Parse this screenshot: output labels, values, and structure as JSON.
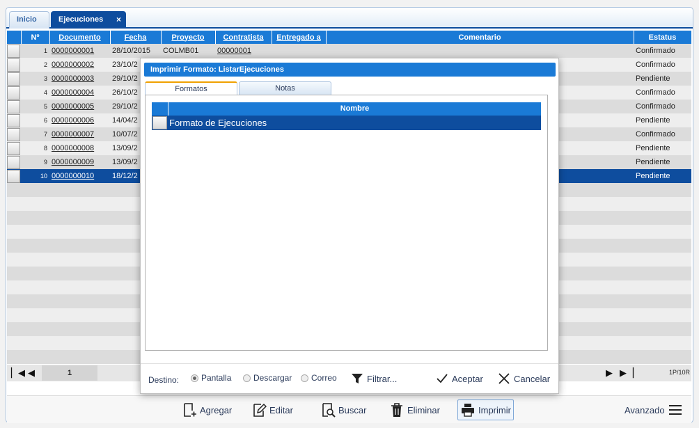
{
  "tabs": [
    {
      "label": "Inicio",
      "active": false
    },
    {
      "label": "Ejecuciones",
      "active": true,
      "close": "×"
    }
  ],
  "grid": {
    "columns": [
      "Nº",
      "Documento",
      "Fecha",
      "Proyecto",
      "Contratista",
      "Entregado a",
      "Comentario",
      "Estatus"
    ],
    "rows": [
      {
        "n": "1",
        "doc": "0000000001",
        "fecha": "28/10/2015",
        "proyecto": "COLMB01",
        "contratista": "00000001",
        "estatus": "Confirmado"
      },
      {
        "n": "2",
        "doc": "0000000002",
        "fecha": "23/10/2",
        "proyecto": "",
        "contratista": "",
        "estatus": "Confirmado"
      },
      {
        "n": "3",
        "doc": "0000000003",
        "fecha": "29/10/2",
        "proyecto": "",
        "contratista": "",
        "estatus": "Pendiente"
      },
      {
        "n": "4",
        "doc": "0000000004",
        "fecha": "26/10/2",
        "proyecto": "",
        "contratista": "",
        "estatus": "Confirmado"
      },
      {
        "n": "5",
        "doc": "0000000005",
        "fecha": "29/10/2",
        "proyecto": "",
        "contratista": "",
        "estatus": "Confirmado"
      },
      {
        "n": "6",
        "doc": "0000000006",
        "fecha": "14/04/2",
        "proyecto": "",
        "contratista": "",
        "estatus": "Pendiente"
      },
      {
        "n": "7",
        "doc": "0000000007",
        "fecha": "10/07/2",
        "proyecto": "",
        "contratista": "",
        "estatus": "Confirmado"
      },
      {
        "n": "8",
        "doc": "0000000008",
        "fecha": "13/09/2",
        "proyecto": "",
        "contratista": "",
        "estatus": "Pendiente"
      },
      {
        "n": "9",
        "doc": "0000000009",
        "fecha": "13/09/2",
        "proyecto": "",
        "contratista": "",
        "estatus": "Pendiente"
      },
      {
        "n": "10",
        "doc": "0000000010",
        "fecha": "18/12/2",
        "proyecto": "",
        "contratista": "",
        "estatus": "Pendiente",
        "selected": true
      }
    ],
    "empty_rows": 13
  },
  "pager": {
    "page": "1",
    "info": "1P/10R"
  },
  "toolbar": {
    "agregar": "Agregar",
    "editar": "Editar",
    "buscar": "Buscar",
    "eliminar": "Eliminar",
    "imprimir": "Imprimir",
    "avanzado": "Avanzado"
  },
  "dialog": {
    "title": "Imprimir Formato: ListarEjecuciones",
    "tabs": [
      "Formatos",
      "Notas"
    ],
    "table_header": "Nombre",
    "formats": [
      "Formato de Ejecuciones"
    ],
    "destino_label": "Destino:",
    "destinos": [
      {
        "label": "Pantalla",
        "checked": true
      },
      {
        "label": "Descargar",
        "checked": false
      },
      {
        "label": "Correo",
        "checked": false
      }
    ],
    "filtrar": "Filtrar...",
    "aceptar": "Aceptar",
    "cancelar": "Cancelar"
  },
  "colors": {
    "accent": "#1a7ad6",
    "selected": "#0e4d9e",
    "tab_highlight": "#f0a100"
  }
}
